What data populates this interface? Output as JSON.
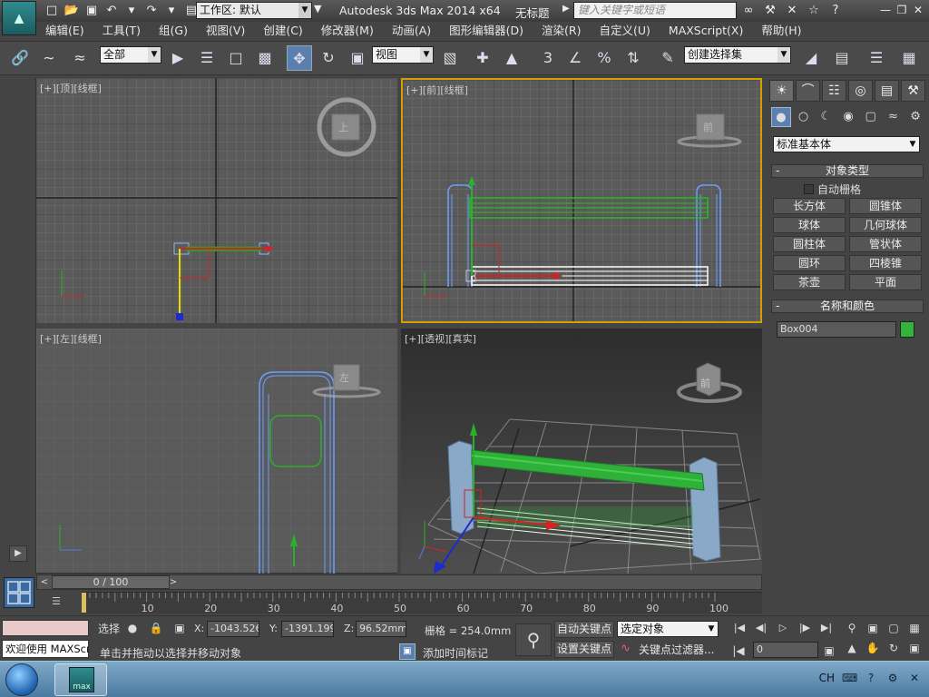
{
  "title": {
    "workspace": "工作区: 默认",
    "app_name": "Autodesk 3ds Max  2014 x64",
    "doc_name": "无标题",
    "search_placeholder": "键入关键字或短语"
  },
  "menu": [
    "编辑(E)",
    "工具(T)",
    "组(G)",
    "视图(V)",
    "创建(C)",
    "修改器(M)",
    "动画(A)",
    "图形编辑器(D)",
    "渲染(R)",
    "自定义(U)",
    "MAXScript(X)",
    "帮助(H)"
  ],
  "toolbar": {
    "selection_filter": "全部",
    "ref_coord": "视图",
    "snap_label": "3",
    "named_selection": "创建选择集"
  },
  "viewports": {
    "top": {
      "label": "[+][顶][线框]",
      "cube": "上"
    },
    "front": {
      "label": "[+][前][线框]",
      "cube": "前"
    },
    "left": {
      "label": "[+][左][线框]",
      "cube": "左"
    },
    "persp": {
      "label": "[+][透视][真实]",
      "cube": "前"
    }
  },
  "command_panel": {
    "category": "标准基本体",
    "rollout_object_type": "对象类型",
    "autogrid_label": "自动栅格",
    "object_buttons": [
      "长方体",
      "圆锥体",
      "球体",
      "几何球体",
      "圆柱体",
      "管状体",
      "圆环",
      "四棱锥",
      "茶壶",
      "平面"
    ],
    "rollout_name_color": "名称和颜色",
    "object_name": "Box004",
    "object_color": "#32b43c"
  },
  "timeline": {
    "frame_display": "0 / 100",
    "ticks": [
      10,
      20,
      30,
      40,
      50,
      60,
      70,
      80,
      90,
      100
    ]
  },
  "status": {
    "maxscript_listener": "欢迎使用 MAXScr",
    "selection_label": "选择",
    "x_label": "X:",
    "x_value": "-1043.526",
    "y_label": "Y:",
    "y_value": "-1391.199",
    "z_label": "Z:",
    "z_value": "96.52mm",
    "grid": "栅格 = 254.0mm",
    "prompt": "单击并拖动以选择并移动对象",
    "add_time_tag": "添加时间标记",
    "auto_key": "自动关键点",
    "set_key": "设置关键点",
    "key_mode": "选定对象",
    "key_filters": "关键点过滤器...",
    "current_frame": "0"
  },
  "taskbar": {
    "app_label": "max",
    "lang": "CH"
  }
}
